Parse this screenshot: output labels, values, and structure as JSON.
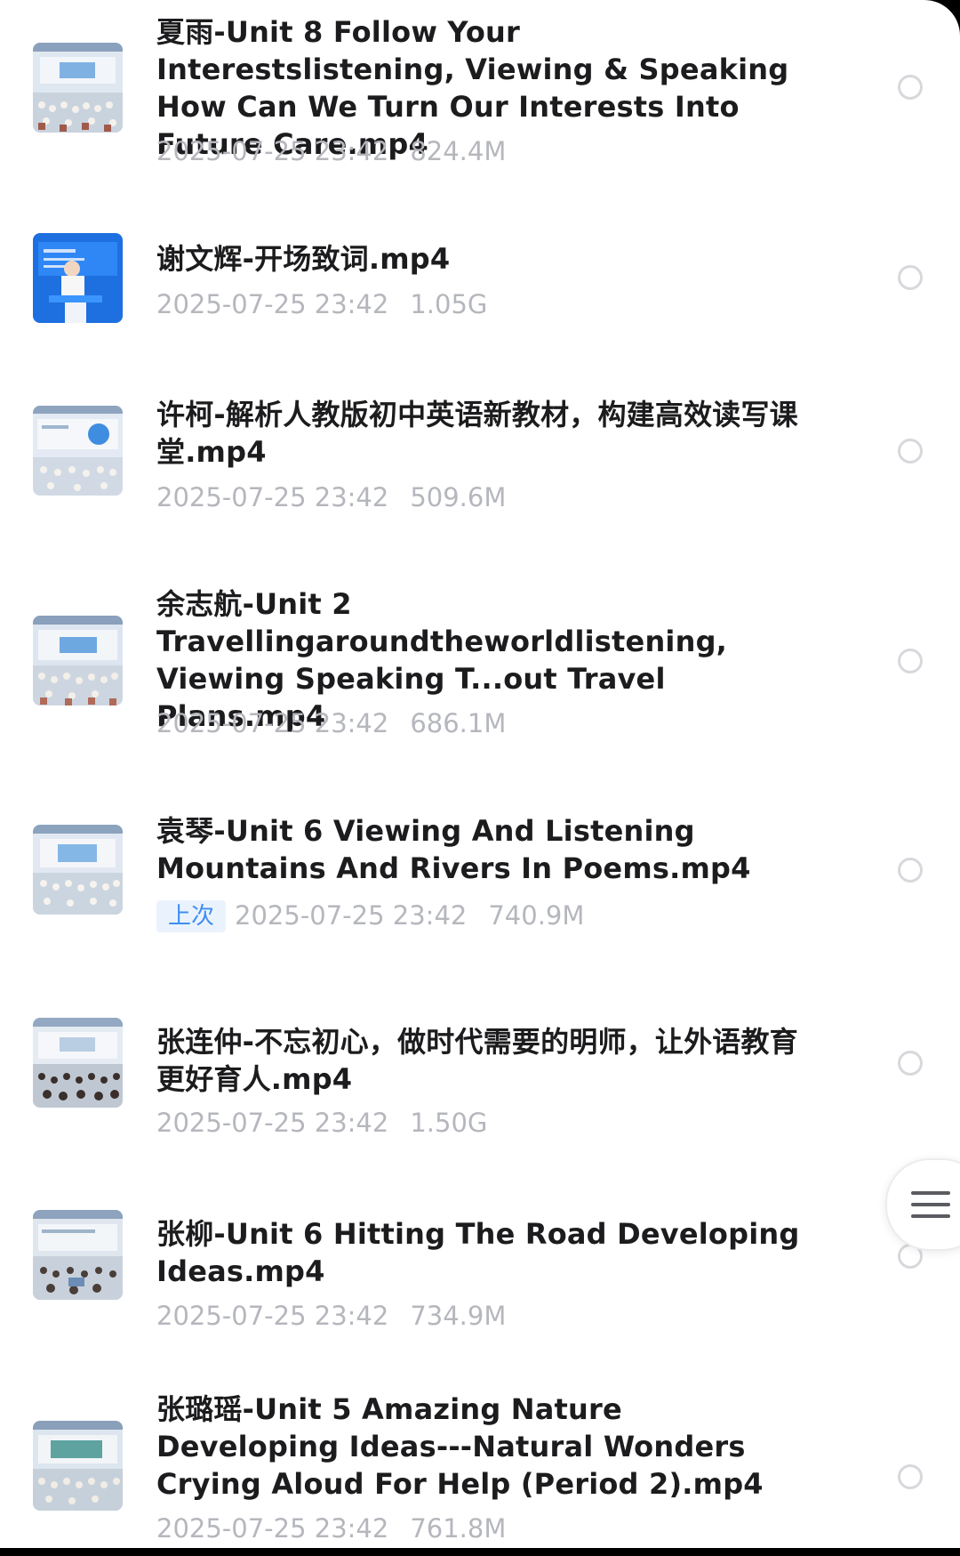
{
  "files": [
    {
      "title": "夏雨-Unit 8 Follow Your Interestslistening, Viewing & Speaking How Can We Turn Our Interests Into Future Care.mp4",
      "date": "2025-07-25 23:42",
      "size": "824.4M",
      "thumbnail": "classroom-stage-photo"
    },
    {
      "title": "谢文辉-开场致词.mp4",
      "date": "2025-07-25 23:42",
      "size": "1.05G",
      "thumbnail": "speaker-podium-photo"
    },
    {
      "title": "许柯-解析人教版初中英语新教材，构建高效读写课堂.mp4",
      "date": "2025-07-25 23:42",
      "size": "509.6M",
      "thumbnail": "lecture-hall-photo"
    },
    {
      "title": "余志航-Unit 2 Travellingaroundtheworldlistening, Viewing  Speaking T...out Travel Plans.mp4",
      "date": "2025-07-25 23:42",
      "size": "686.1M",
      "thumbnail": "classroom-stage-photo"
    },
    {
      "title": "袁琴-Unit 6 Viewing And Listening Mountains And Rivers In Poems.mp4",
      "badge": "上次",
      "date": "2025-07-25 23:42",
      "size": "740.9M",
      "thumbnail": "classroom-stage-photo"
    },
    {
      "title": "张连仲-不忘初心，做时代需要的明师，让外语教育更好育人.mp4",
      "date": "2025-07-25 23:42",
      "size": "1.50G",
      "thumbnail": "audience-hall-photo"
    },
    {
      "title": "张柳-Unit 6 Hitting The Road Developing Ideas.mp4",
      "date": "2025-07-25 23:42",
      "size": "734.9M",
      "thumbnail": "classroom-stage-photo"
    },
    {
      "title": "张璐瑶-Unit 5 Amazing Nature Developing Ideas---Natural Wonders Crying Aloud For Help (Period 2).mp4",
      "date": "2025-07-25 23:42",
      "size": "761.8M",
      "thumbnail": "classroom-stage-photo"
    }
  ],
  "icons": {
    "select": "radio-circle-icon",
    "floating_menu": "menu-lines-icon"
  },
  "colors": {
    "title_text": "#1c1c1e",
    "meta_text": "#b5b7bd",
    "badge_text": "#3f8ef0",
    "badge_bg": "#eaf3fd"
  }
}
